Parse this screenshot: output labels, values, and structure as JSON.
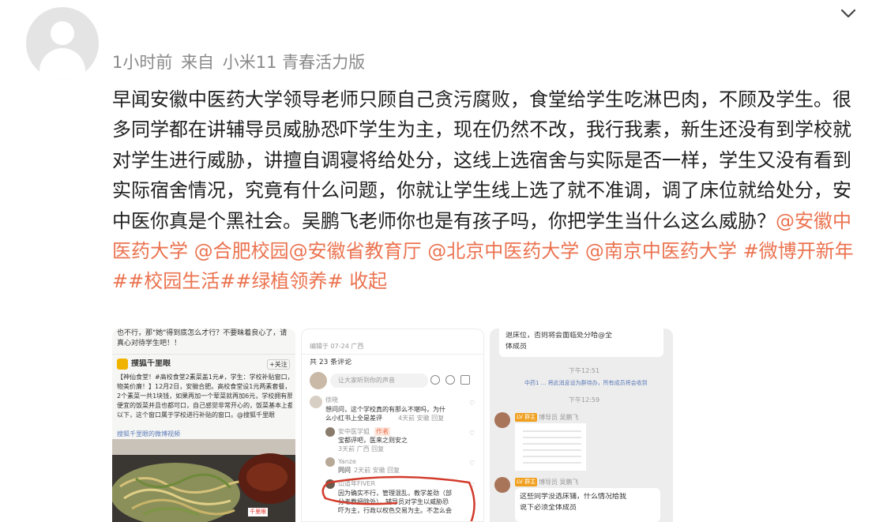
{
  "post": {
    "meta": {
      "time": "1小时前",
      "from": "来自",
      "device": "小米11 青春活力版"
    },
    "text": {
      "body": "早闻安徽中医药大学领导老师只顾自己贪污腐败，食堂给学生吃淋巴肉，不顾及学生。很多同学都在讲辅导员威胁恐吓学生为主，现在仍然不改，我行我素，新生还没有到学校就对学生进行威胁，讲擅自调寝将给处分，这线上选宿舍与实际是否一样，学生又没有看到实际宿舍情况，究竟有什么问题，你就让学生线上选了就不准调，调了床位就给处分，安中医你真是个黑社会。吴鹏飞老师你也是有孩子吗，你把学生当什么这么威胁？",
      "mentions": [
        "@安徽中医药大学",
        "@合肥校园",
        "@安徽省教育厅",
        "@北京中医药大学",
        "@南京中医药大学"
      ],
      "hashtags": [
        "#微博开新年#",
        "#校园生活#",
        "#绿植领养#"
      ],
      "collapse": "收起"
    }
  },
  "icons": {
    "collapse": "chevron-down-icon",
    "avatar": "default-avatar-icon"
  },
  "colors": {
    "link": "#eb7350",
    "meta": "#8a8a8a",
    "text": "#222222"
  },
  "images": {
    "img1": {
      "top": "也不行，那\"她\"得到底怎么才行？不要昧着良心了，请真心对待学生吧！！",
      "source": "搜狐千里眼",
      "follow": "+关注",
      "body1": "【神仙食堂！#高校食堂2素菜盖1元#，学生：学校补贴窗口，",
      "body2": "物美价廉！】12月2日，安徽合肥。高校食堂设1元两素套餐，",
      "body3": "2个素菜一共1块钱，如果再加一个荤菜就再加6元，学校拥有那么",
      "body4": "便宜的饭菜并且也都可口，自己感觉非常开心的，饭菜基本上都是",
      "body5": "以下，这个窗口属于学校进行补贴的窗口。@搜狐千里眼",
      "video": "搜狐千里眼的微博视频",
      "badge": "千里眼"
    },
    "img2": {
      "header": "编辑于 07-24 广西",
      "count": "共 23 条评论",
      "input": "让大家听到你的声音",
      "c1name": "徐晓",
      "c1text1": "想问问，这个学校真的有那么不堪吗，为什",
      "c1text2": "么小红书上全是差评",
      "c1meta": "4天前 安徽 回复",
      "c2name": "安中医学姐",
      "c2tag": "作者",
      "c2text": "宝都评吧，医来之则安之",
      "c2meta": "3天前 广西 回复",
      "c3name": "Yanze",
      "c3text": "同问",
      "c3meta": "2天前 安徽 回复",
      "c4name": "山道年FIVER",
      "c4text1": "因为确实不行，管理混乱，教学差劲（部",
      "c4text2": "分老教授除外），辅导员对学生以威胁恐",
      "c4text3": "吓为主，行政以权色交易为主。不怎么会"
    },
    "img3": {
      "top1": "退床位，否则将会面临处分哈@全",
      "top2": "体成员",
      "time1": "下午12:51",
      "notice": "中药1 ... 将此消息设为群待办，所有成员将会收到",
      "time2": "下午12:59",
      "sender": "博导员 吴鹏飞",
      "tag": "LV 群主",
      "text1": "这些同学没选床铺，什么情况给我",
      "text2": "说下必须全体成员"
    }
  }
}
